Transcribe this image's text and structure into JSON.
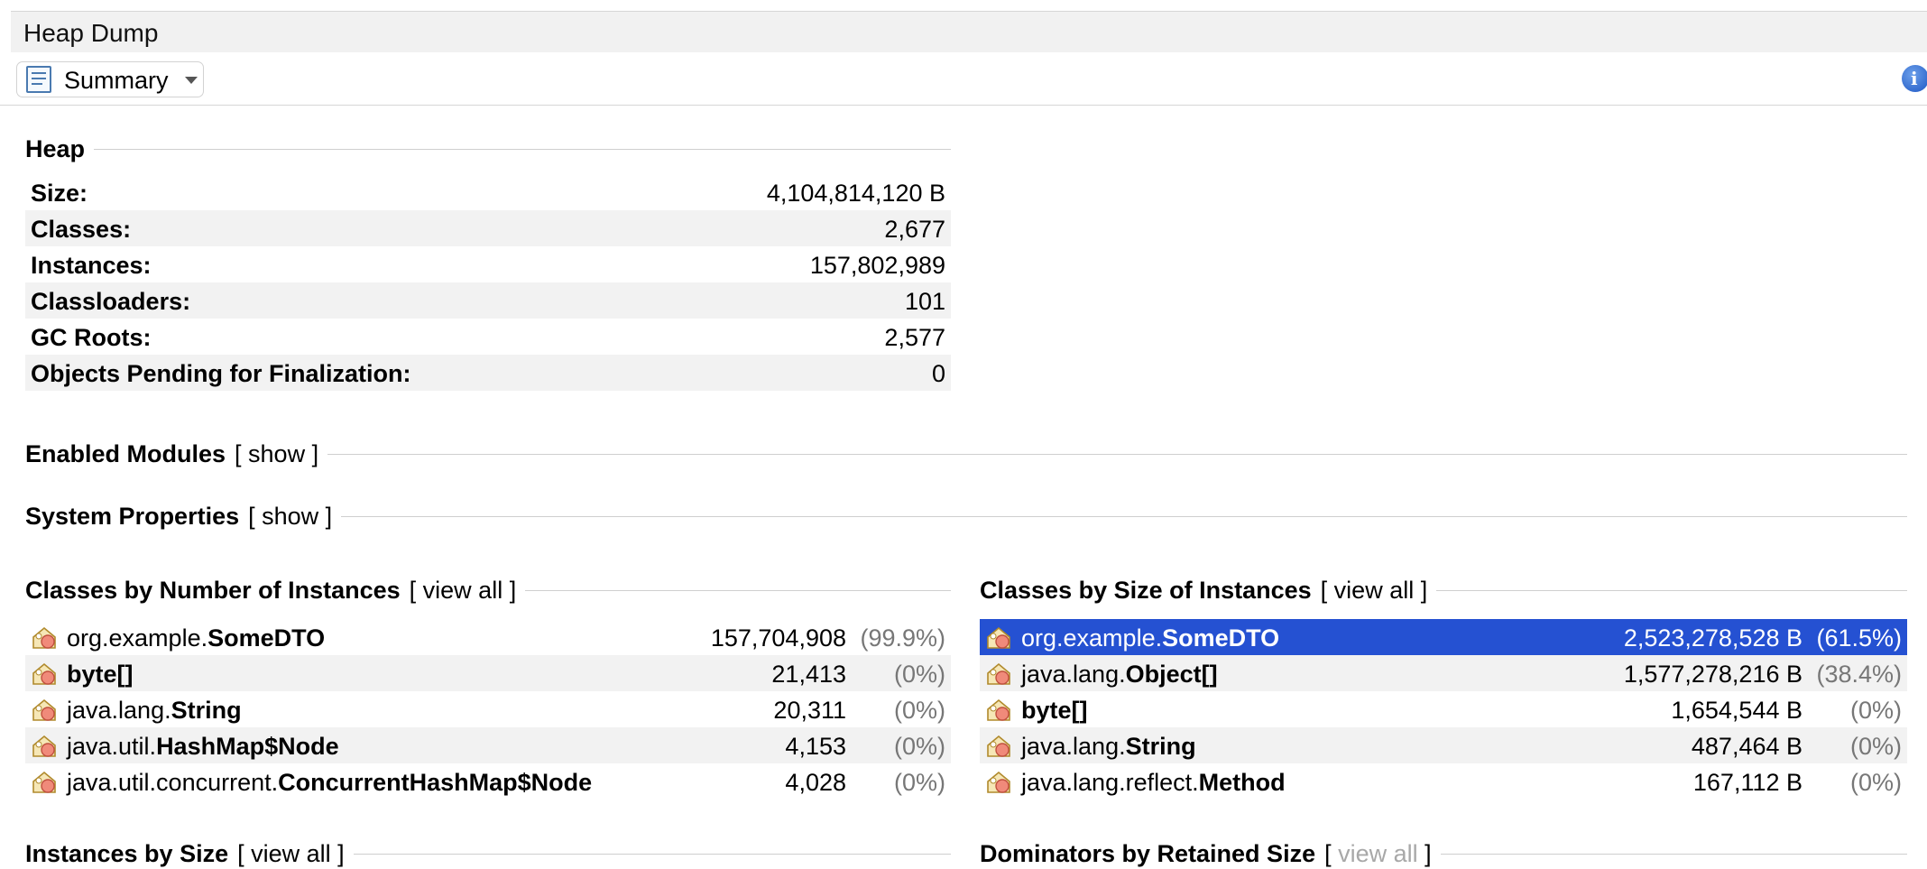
{
  "window": {
    "tab_title": "Heap Dump"
  },
  "toolbar": {
    "view_label": "Summary",
    "view_icon": "document-icon",
    "info_icon": "info-icon"
  },
  "heap": {
    "title": "Heap",
    "rows": [
      {
        "label": "Size:",
        "value": "4,104,814,120 B"
      },
      {
        "label": "Classes:",
        "value": "2,677"
      },
      {
        "label": "Instances:",
        "value": "157,802,989"
      },
      {
        "label": "Classloaders:",
        "value": "101"
      },
      {
        "label": "GC Roots:",
        "value": "2,577"
      },
      {
        "label": "Objects Pending for Finalization:",
        "value": "0"
      }
    ]
  },
  "enabled_modules": {
    "title": "Enabled Modules",
    "link": "[ show ]"
  },
  "system_properties": {
    "title": "System Properties",
    "link": "[ show ]"
  },
  "by_instances": {
    "title": "Classes by Number of Instances",
    "link": "[ view all ]",
    "rows": [
      {
        "pkg": "org.example.",
        "cls": "SomeDTO",
        "value": "157,704,908",
        "pct": "(99.9%)"
      },
      {
        "pkg": "",
        "cls": "byte[]",
        "value": "21,413",
        "pct": "(0%)"
      },
      {
        "pkg": "java.lang.",
        "cls": "String",
        "value": "20,311",
        "pct": "(0%)"
      },
      {
        "pkg": "java.util.",
        "cls": "HashMap$Node",
        "value": "4,153",
        "pct": "(0%)"
      },
      {
        "pkg": "java.util.concurrent.",
        "cls": "ConcurrentHashMap$Node",
        "value": "4,028",
        "pct": "(0%)"
      }
    ]
  },
  "by_size": {
    "title": "Classes by Size of Instances",
    "link": "[ view all ]",
    "rows": [
      {
        "pkg": "org.example.",
        "cls": "SomeDTO",
        "value": "2,523,278,528 B",
        "pct": "(61.5%)",
        "selected": true
      },
      {
        "pkg": "java.lang.",
        "cls": "Object[]",
        "value": "1,577,278,216 B",
        "pct": "(38.4%)"
      },
      {
        "pkg": "",
        "cls": "byte[]",
        "value": "1,654,544 B",
        "pct": "(0%)"
      },
      {
        "pkg": "java.lang.",
        "cls": "String",
        "value": "487,464 B",
        "pct": "(0%)"
      },
      {
        "pkg": "java.lang.reflect.",
        "cls": "Method",
        "value": "167,112 B",
        "pct": "(0%)"
      }
    ]
  },
  "instances_by_size": {
    "title": "Instances by Size",
    "link": "[ view all ]"
  },
  "dominators": {
    "title": "Dominators by Retained Size",
    "link_open": "[",
    "link": "view all",
    "link_close": "]"
  },
  "colors": {
    "selection": "#2551d2",
    "stripe": "#f2f2f2",
    "muted": "#777777",
    "disabled": "#a8a8a8"
  }
}
